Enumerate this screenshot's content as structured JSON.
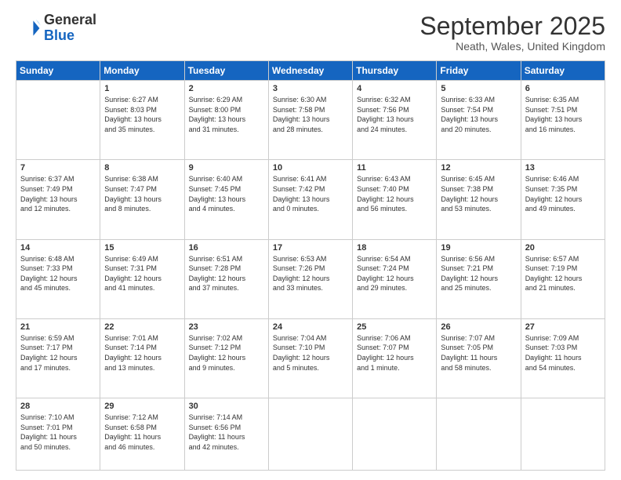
{
  "header": {
    "logo_line1": "General",
    "logo_line2": "Blue",
    "month": "September 2025",
    "location": "Neath, Wales, United Kingdom"
  },
  "days_of_week": [
    "Sunday",
    "Monday",
    "Tuesday",
    "Wednesday",
    "Thursday",
    "Friday",
    "Saturday"
  ],
  "weeks": [
    [
      {
        "num": "",
        "detail": ""
      },
      {
        "num": "1",
        "detail": "Sunrise: 6:27 AM\nSunset: 8:03 PM\nDaylight: 13 hours\nand 35 minutes."
      },
      {
        "num": "2",
        "detail": "Sunrise: 6:29 AM\nSunset: 8:00 PM\nDaylight: 13 hours\nand 31 minutes."
      },
      {
        "num": "3",
        "detail": "Sunrise: 6:30 AM\nSunset: 7:58 PM\nDaylight: 13 hours\nand 28 minutes."
      },
      {
        "num": "4",
        "detail": "Sunrise: 6:32 AM\nSunset: 7:56 PM\nDaylight: 13 hours\nand 24 minutes."
      },
      {
        "num": "5",
        "detail": "Sunrise: 6:33 AM\nSunset: 7:54 PM\nDaylight: 13 hours\nand 20 minutes."
      },
      {
        "num": "6",
        "detail": "Sunrise: 6:35 AM\nSunset: 7:51 PM\nDaylight: 13 hours\nand 16 minutes."
      }
    ],
    [
      {
        "num": "7",
        "detail": "Sunrise: 6:37 AM\nSunset: 7:49 PM\nDaylight: 13 hours\nand 12 minutes."
      },
      {
        "num": "8",
        "detail": "Sunrise: 6:38 AM\nSunset: 7:47 PM\nDaylight: 13 hours\nand 8 minutes."
      },
      {
        "num": "9",
        "detail": "Sunrise: 6:40 AM\nSunset: 7:45 PM\nDaylight: 13 hours\nand 4 minutes."
      },
      {
        "num": "10",
        "detail": "Sunrise: 6:41 AM\nSunset: 7:42 PM\nDaylight: 13 hours\nand 0 minutes."
      },
      {
        "num": "11",
        "detail": "Sunrise: 6:43 AM\nSunset: 7:40 PM\nDaylight: 12 hours\nand 56 minutes."
      },
      {
        "num": "12",
        "detail": "Sunrise: 6:45 AM\nSunset: 7:38 PM\nDaylight: 12 hours\nand 53 minutes."
      },
      {
        "num": "13",
        "detail": "Sunrise: 6:46 AM\nSunset: 7:35 PM\nDaylight: 12 hours\nand 49 minutes."
      }
    ],
    [
      {
        "num": "14",
        "detail": "Sunrise: 6:48 AM\nSunset: 7:33 PM\nDaylight: 12 hours\nand 45 minutes."
      },
      {
        "num": "15",
        "detail": "Sunrise: 6:49 AM\nSunset: 7:31 PM\nDaylight: 12 hours\nand 41 minutes."
      },
      {
        "num": "16",
        "detail": "Sunrise: 6:51 AM\nSunset: 7:28 PM\nDaylight: 12 hours\nand 37 minutes."
      },
      {
        "num": "17",
        "detail": "Sunrise: 6:53 AM\nSunset: 7:26 PM\nDaylight: 12 hours\nand 33 minutes."
      },
      {
        "num": "18",
        "detail": "Sunrise: 6:54 AM\nSunset: 7:24 PM\nDaylight: 12 hours\nand 29 minutes."
      },
      {
        "num": "19",
        "detail": "Sunrise: 6:56 AM\nSunset: 7:21 PM\nDaylight: 12 hours\nand 25 minutes."
      },
      {
        "num": "20",
        "detail": "Sunrise: 6:57 AM\nSunset: 7:19 PM\nDaylight: 12 hours\nand 21 minutes."
      }
    ],
    [
      {
        "num": "21",
        "detail": "Sunrise: 6:59 AM\nSunset: 7:17 PM\nDaylight: 12 hours\nand 17 minutes."
      },
      {
        "num": "22",
        "detail": "Sunrise: 7:01 AM\nSunset: 7:14 PM\nDaylight: 12 hours\nand 13 minutes."
      },
      {
        "num": "23",
        "detail": "Sunrise: 7:02 AM\nSunset: 7:12 PM\nDaylight: 12 hours\nand 9 minutes."
      },
      {
        "num": "24",
        "detail": "Sunrise: 7:04 AM\nSunset: 7:10 PM\nDaylight: 12 hours\nand 5 minutes."
      },
      {
        "num": "25",
        "detail": "Sunrise: 7:06 AM\nSunset: 7:07 PM\nDaylight: 12 hours\nand 1 minute."
      },
      {
        "num": "26",
        "detail": "Sunrise: 7:07 AM\nSunset: 7:05 PM\nDaylight: 11 hours\nand 58 minutes."
      },
      {
        "num": "27",
        "detail": "Sunrise: 7:09 AM\nSunset: 7:03 PM\nDaylight: 11 hours\nand 54 minutes."
      }
    ],
    [
      {
        "num": "28",
        "detail": "Sunrise: 7:10 AM\nSunset: 7:01 PM\nDaylight: 11 hours\nand 50 minutes."
      },
      {
        "num": "29",
        "detail": "Sunrise: 7:12 AM\nSunset: 6:58 PM\nDaylight: 11 hours\nand 46 minutes."
      },
      {
        "num": "30",
        "detail": "Sunrise: 7:14 AM\nSunset: 6:56 PM\nDaylight: 11 hours\nand 42 minutes."
      },
      {
        "num": "",
        "detail": ""
      },
      {
        "num": "",
        "detail": ""
      },
      {
        "num": "",
        "detail": ""
      },
      {
        "num": "",
        "detail": ""
      }
    ]
  ]
}
